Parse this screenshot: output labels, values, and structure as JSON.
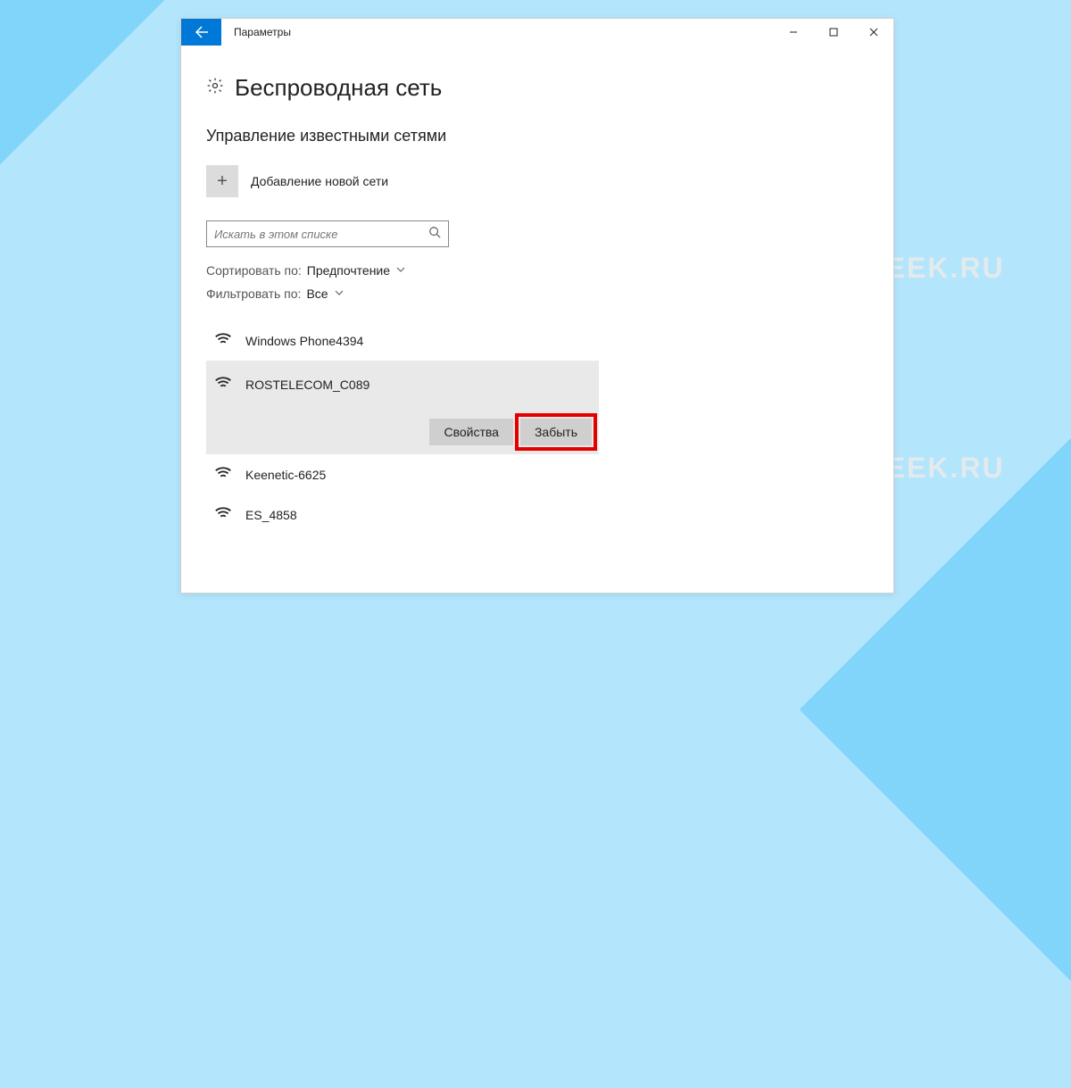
{
  "titlebar": {
    "title": "Параметры"
  },
  "page": {
    "title": "Беспроводная сеть",
    "section_title": "Управление известными сетями"
  },
  "add": {
    "label": "Добавление новой сети"
  },
  "search": {
    "placeholder": "Искать в этом списке"
  },
  "sort": {
    "label": "Сортировать по:",
    "value": "Предпочтение"
  },
  "filter": {
    "label": "Фильтровать по:",
    "value": "Все"
  },
  "networks": [
    {
      "name": "Windows Phone4394"
    },
    {
      "name": "ROSTELECOM_C089"
    },
    {
      "name": "Keenetic-6625"
    },
    {
      "name": "ES_4858"
    }
  ],
  "actions": {
    "properties": "Свойства",
    "forget": "Забыть"
  },
  "watermark": "TECH-GEEK.RU"
}
